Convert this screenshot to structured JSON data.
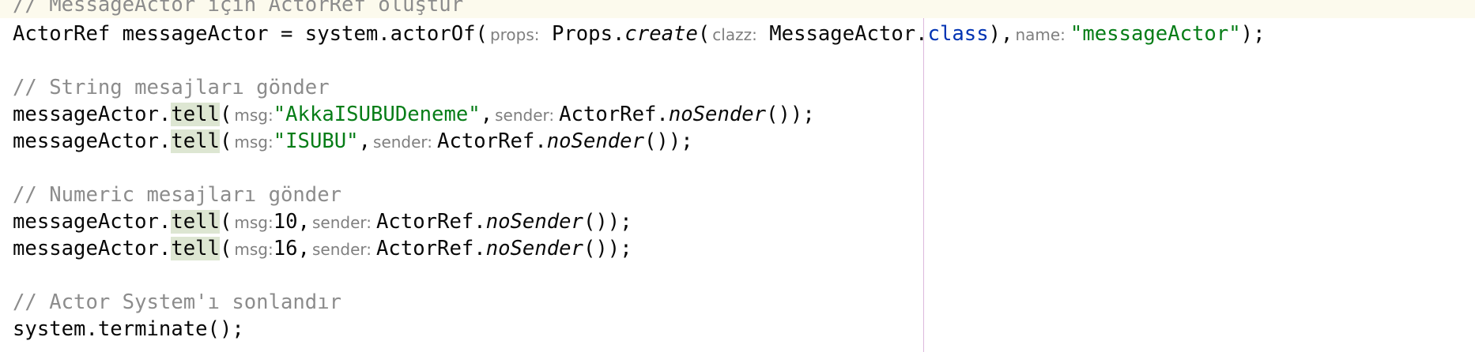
{
  "code": {
    "l1_comment": "// MessageActor için ActorRef oluştur",
    "l2_pre": "ActorRef messageActor = system.actorOf(",
    "l2_hint_props": "props:",
    "l2_props": "Props.",
    "l2_create": "create",
    "l2_paren": "(",
    "l2_hint_clazz": "clazz:",
    "l2_cls": "MessageActor.",
    "l2_class_kw": "class",
    "l2_comma": "),",
    "l2_hint_name": "name:",
    "l2_name_str": "\"messageActor\"",
    "l2_end": ");",
    "l4_comment": "// String mesajları gönder",
    "obj": "messageActor.",
    "tell": "tell",
    "open": "(",
    "hint_msg": "msg:",
    "hint_sender": "sender:",
    "actorref": "ActorRef.",
    "nosender": "noSender",
    "tail": "());",
    "sep": ",",
    "l5_str": "\"AkkaISUBUDeneme\"",
    "l6_str": "\"ISUBU\"",
    "l8_comment": "// Numeric mesajları gönder",
    "l9_num": "10",
    "l10_num": "16",
    "l12_comment": "// Actor System'ı sonlandır",
    "l13_code": "system.terminate();"
  },
  "colors": {
    "comment": "#8c8c8c",
    "string": "#067d17",
    "keyword": "#0033b3",
    "highlight": "#dde6d2",
    "current_line": "#fcfaed"
  }
}
